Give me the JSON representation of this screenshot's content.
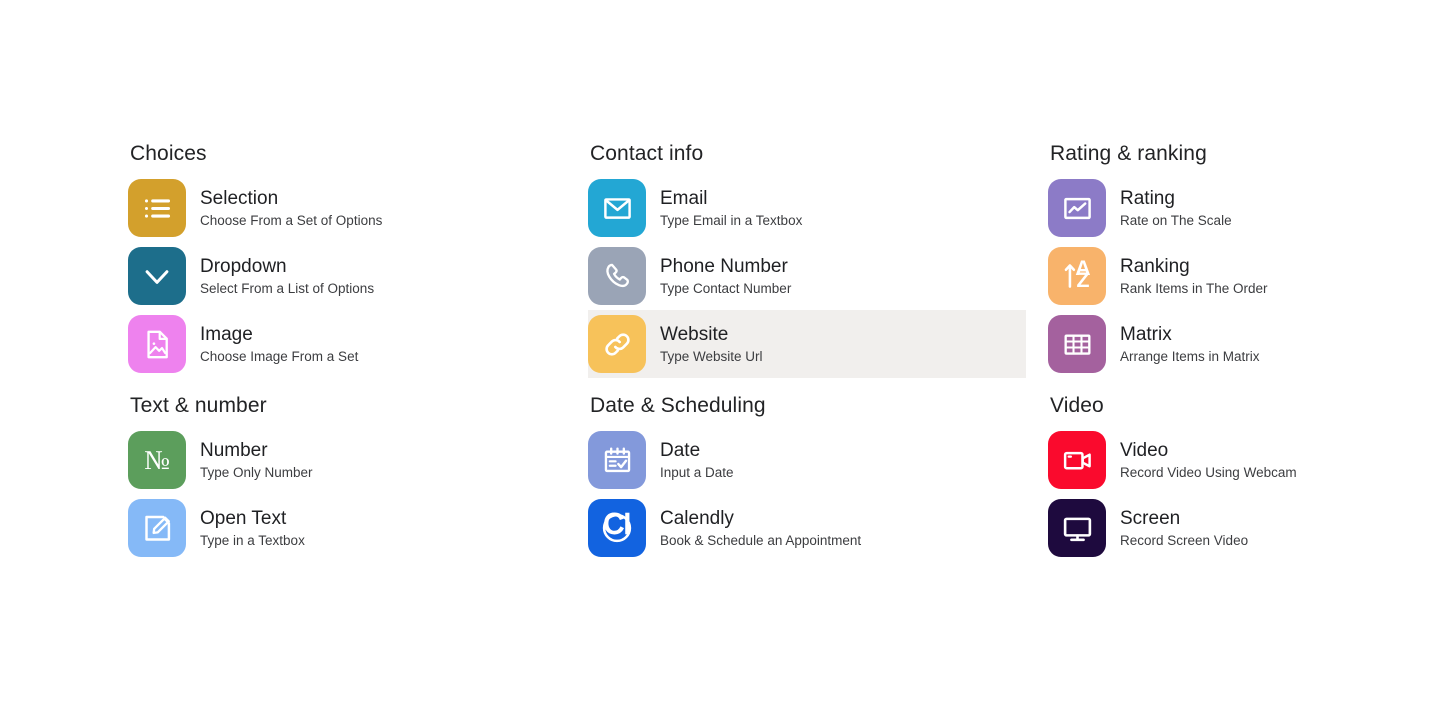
{
  "columns": [
    {
      "name": "column-1",
      "groups": [
        {
          "title": "Choices",
          "items": [
            {
              "title": "Selection",
              "subtitle": "Choose From a Set of Options",
              "icon": "list-icon",
              "color": "#D3A02C",
              "highlighted": false
            },
            {
              "title": "Dropdown",
              "subtitle": "Select From a List of Options",
              "icon": "chevron-down-icon",
              "color": "#1D6E8B",
              "highlighted": false
            },
            {
              "title": "Image",
              "subtitle": "Choose Image From a Set",
              "icon": "image-file-icon",
              "color": "#EE82EE",
              "highlighted": false
            }
          ]
        },
        {
          "title": "Text & number",
          "items": [
            {
              "title": "Number",
              "subtitle": "Type Only Number",
              "icon": "numero-icon",
              "color": "#5C9E5C",
              "highlighted": false
            },
            {
              "title": "Open Text",
              "subtitle": "Type in a Textbox",
              "icon": "edit-square-icon",
              "color": "#85B9F7",
              "highlighted": false
            }
          ]
        }
      ]
    },
    {
      "name": "column-2",
      "groups": [
        {
          "title": "Contact info",
          "items": [
            {
              "title": "Email",
              "subtitle": "Type Email in a Textbox",
              "icon": "envelope-icon",
              "color": "#23A7D4",
              "highlighted": false
            },
            {
              "title": "Phone Number",
              "subtitle": "Type Contact Number",
              "icon": "phone-icon",
              "color": "#9AA4B6",
              "highlighted": false
            },
            {
              "title": "Website",
              "subtitle": "Type Website Url",
              "icon": "link-icon",
              "color": "#F7C25A",
              "highlighted": true
            }
          ]
        },
        {
          "title": "Date & Scheduling",
          "items": [
            {
              "title": "Date",
              "subtitle": "Input a Date",
              "icon": "calendar-check-icon",
              "color": "#8399DB",
              "highlighted": false
            },
            {
              "title": "Calendly",
              "subtitle": "Book & Schedule an Appointment",
              "icon": "calendly-icon",
              "color": "#1263E0",
              "highlighted": false
            }
          ]
        }
      ]
    },
    {
      "name": "column-3",
      "groups": [
        {
          "title": "Rating & ranking",
          "items": [
            {
              "title": "Rating",
              "subtitle": "Rate on The Scale",
              "icon": "chart-frame-icon",
              "color": "#8C7BC7",
              "highlighted": false
            },
            {
              "title": "Ranking",
              "subtitle": "Rank Items in The Order",
              "icon": "sort-az-icon",
              "color": "#F8B36B",
              "highlighted": false
            },
            {
              "title": "Matrix",
              "subtitle": "Arrange Items in Matrix",
              "icon": "grid-icon",
              "color": "#A4619E",
              "highlighted": false
            }
          ]
        },
        {
          "title": "Video",
          "items": [
            {
              "title": "Video",
              "subtitle": "Record Video Using Webcam",
              "icon": "video-camera-icon",
              "color": "#FA0A2D",
              "highlighted": false
            },
            {
              "title": "Screen",
              "subtitle": "Record Screen Video",
              "icon": "monitor-icon",
              "color": "#1E0A3E",
              "highlighted": false
            }
          ]
        }
      ]
    }
  ],
  "highlight_color": "#F1EFED",
  "icon_glyph_color": "#FFFFFF"
}
